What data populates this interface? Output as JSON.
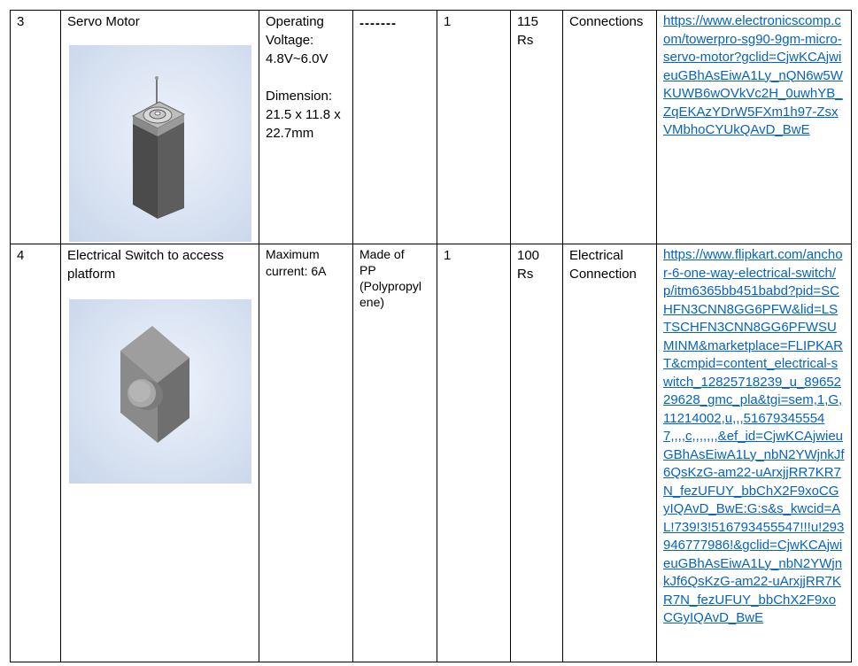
{
  "rows": [
    {
      "no": "3",
      "name": "Servo Motor",
      "image": {
        "icon": "servo-motor-render"
      },
      "spec_lines": [
        "Operating",
        "Voltage:",
        "4.8V~6.0V"
      ],
      "spec_lines2": [
        "Dimension:",
        "21.5 x 11.8 x",
        "22.7mm"
      ],
      "material": "-------",
      "qty": "1",
      "price_lines": [
        "115",
        "Rs"
      ],
      "purpose": "Connections",
      "link": "https://www.electronicscomp.com/towerpro-sg90-9gm-micro-servo-motor?gclid=CjwKCAjwieuGBhAsEiwA1Ly_nQN6w5WKUWB6wOVkVc2H_0uwhYB_ZqEKAzYDrW5FXm1h97-ZsxVMbhoCYUkQAvD_BwE"
    },
    {
      "no": "4",
      "name": "Electrical Switch to access platform",
      "image": {
        "icon": "electrical-switch-render"
      },
      "spec_lines": [
        "Maximum",
        "current: 6A"
      ],
      "material_lines": [
        "Made of",
        "PP",
        "(Polypropyl",
        "ene)"
      ],
      "qty": "1",
      "price_lines": [
        "100",
        "Rs"
      ],
      "purpose_lines": [
        "Electrical",
        "Connection"
      ],
      "link": "https://www.flipkart.com/anchor-6-one-way-electrical-switch/p/itm6365bb451babd?pid=SCHFN3CNN8GG6PFW&lid=LSTSCHFN3CNN8GG6PFWSUMINM&marketplace=FLIPKART&cmpid=content_electrical-switch_12825718239_u_8965229628_gmc_pla&tgi=sem,1,G,11214002,u,,,516793455547,,,,c,,,,,,,&ef_id=CjwKCAjwieuGBhAsEiwA1Ly_nbN2YWjnkJf6QsKzG-am22-uArxjjRR7KR7N_fezUFUY_bbChX2F9xoCGyIQAvD_BwE:G:s&s_kwcid=AL!739!3!516793455547!!!u!293946777986!&gclid=CjwKCAjwieuGBhAsEiwA1Ly_nbN2YWjnkJf6QsKzG-am22-uArxjjRR7KR7N_fezUFUY_bbChX2F9xoCGyIQAvD_BwE"
    }
  ]
}
